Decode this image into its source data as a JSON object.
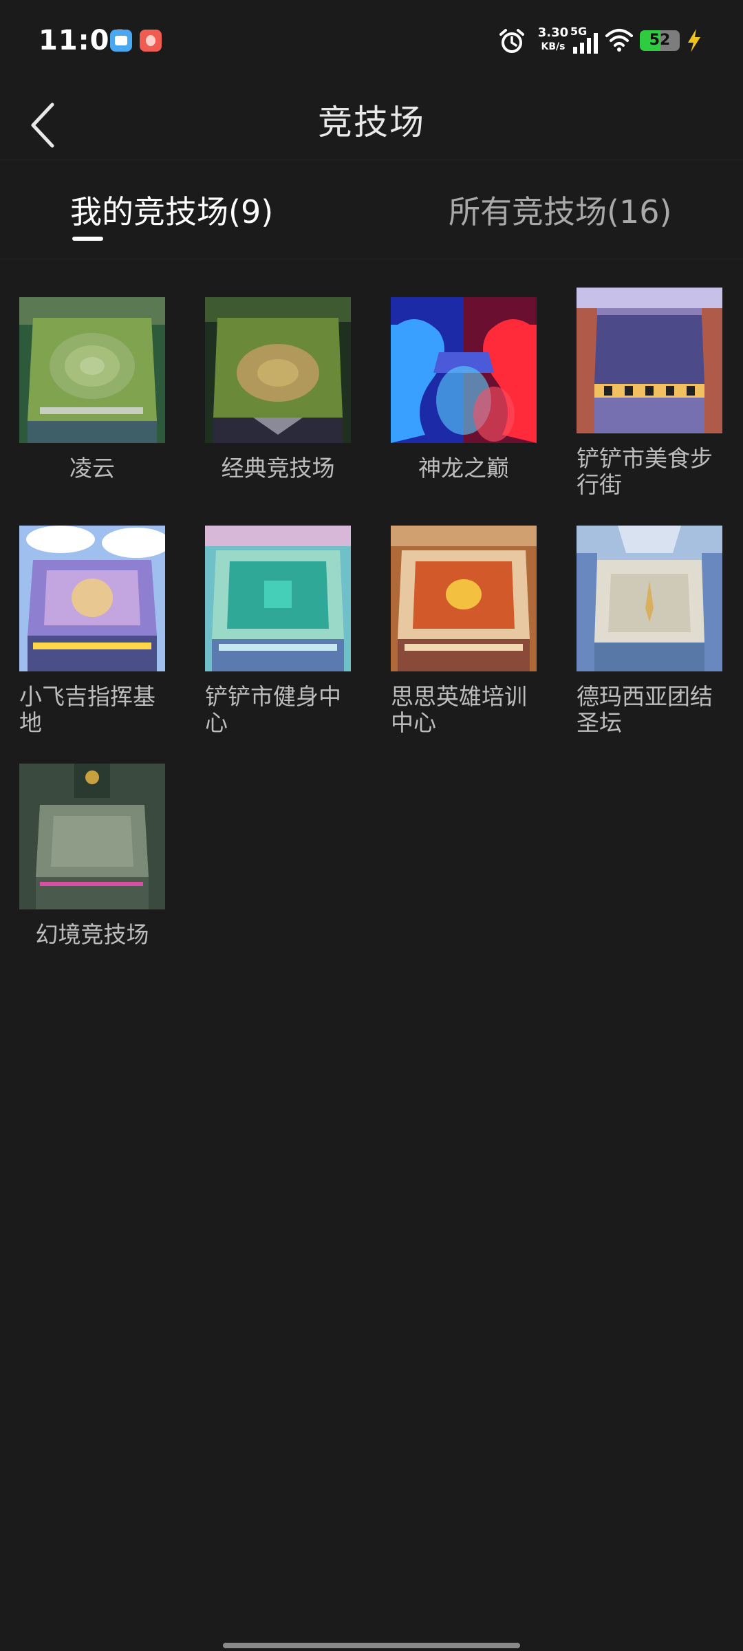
{
  "status_bar": {
    "time": "11:01",
    "net_speed_value": "3.30",
    "net_speed_unit": "KB/s",
    "network_type": "5G",
    "battery_level": "52",
    "battery_fraction": 0.52,
    "icons": [
      "app-notification-icon-blue",
      "app-notification-icon-red",
      "alarm-icon",
      "signal-icon",
      "wifi-icon",
      "battery-icon",
      "charging-icon"
    ]
  },
  "header": {
    "title": "竞技场",
    "back_icon": "chevron-left-icon"
  },
  "tabs": [
    {
      "label": "我的竞技场(9)",
      "active": true
    },
    {
      "label": "所有竞技场(16)",
      "active": false
    }
  ],
  "arenas": [
    {
      "name": "凌云"
    },
    {
      "name": "经典竞技场"
    },
    {
      "name": "神龙之巅"
    },
    {
      "name": "铲铲市美食步行街"
    },
    {
      "name": "小飞吉指挥基地"
    },
    {
      "name": "铲铲市健身中心"
    },
    {
      "name": "思思英雄培训中心"
    },
    {
      "name": "德玛西亚团结圣坛"
    },
    {
      "name": "幻境竞技场"
    }
  ],
  "colors": {
    "background": "#1b1b1b",
    "active_tab": "#ffffff",
    "inactive_tab": "#a9a9a9",
    "label": "#bdbdbd",
    "battery_fill": "#2ecc40"
  }
}
